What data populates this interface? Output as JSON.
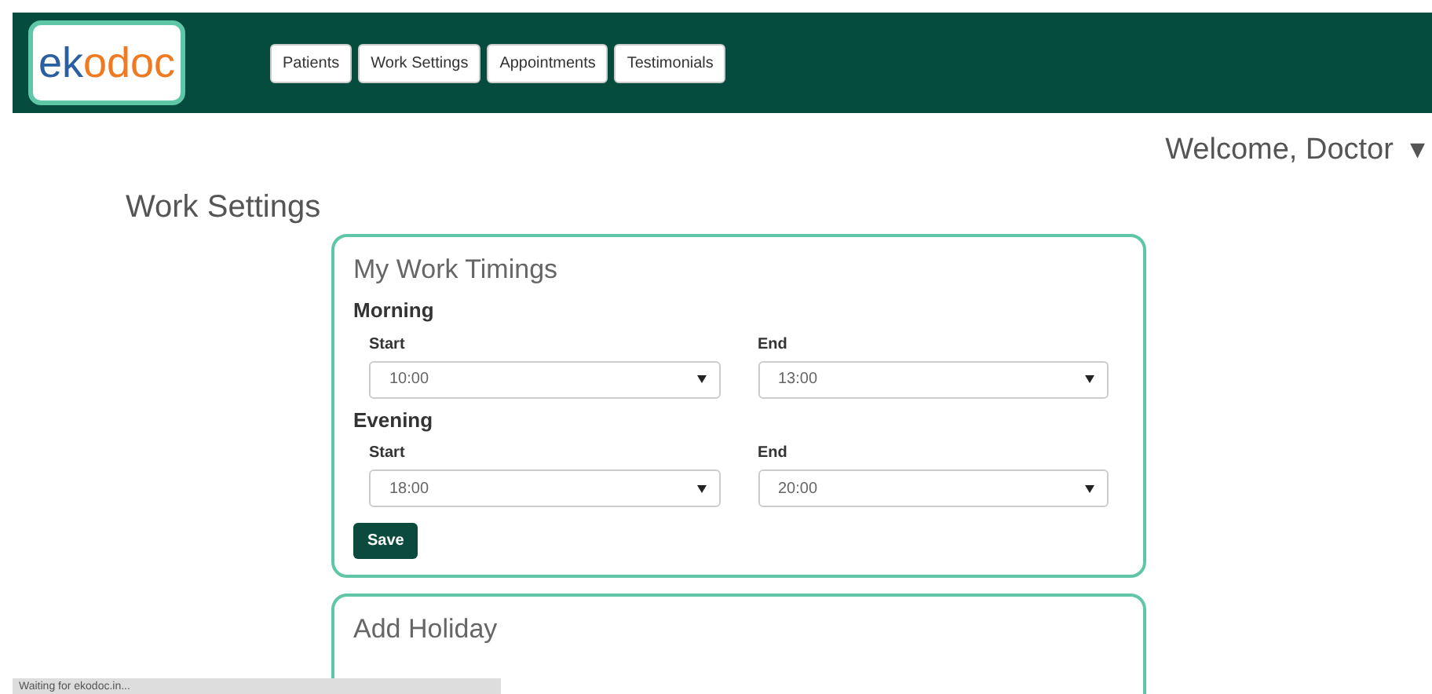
{
  "brand": {
    "logo_text": "ekodoc"
  },
  "nav": [
    {
      "label": "Patients"
    },
    {
      "label": "Work Settings"
    },
    {
      "label": "Appointments"
    },
    {
      "label": "Testimonials"
    }
  ],
  "user_menu": {
    "label": "Welcome, Doctor",
    "caret": "▾"
  },
  "page_title": "Work Settings",
  "work_timings": {
    "title": "My Work Timings",
    "groups": [
      {
        "label": "Morning",
        "fields": [
          {
            "label": "Start",
            "value": "10:00"
          },
          {
            "label": "End",
            "value": "13:00"
          }
        ]
      },
      {
        "label": "Evening",
        "fields": [
          {
            "label": "Start",
            "value": "18:00"
          },
          {
            "label": "End",
            "value": "20:00"
          }
        ]
      }
    ],
    "save_button": "Save"
  },
  "holiday": {
    "title": "Add Holiday"
  },
  "status_bar": "Waiting for ekodoc.in..."
}
